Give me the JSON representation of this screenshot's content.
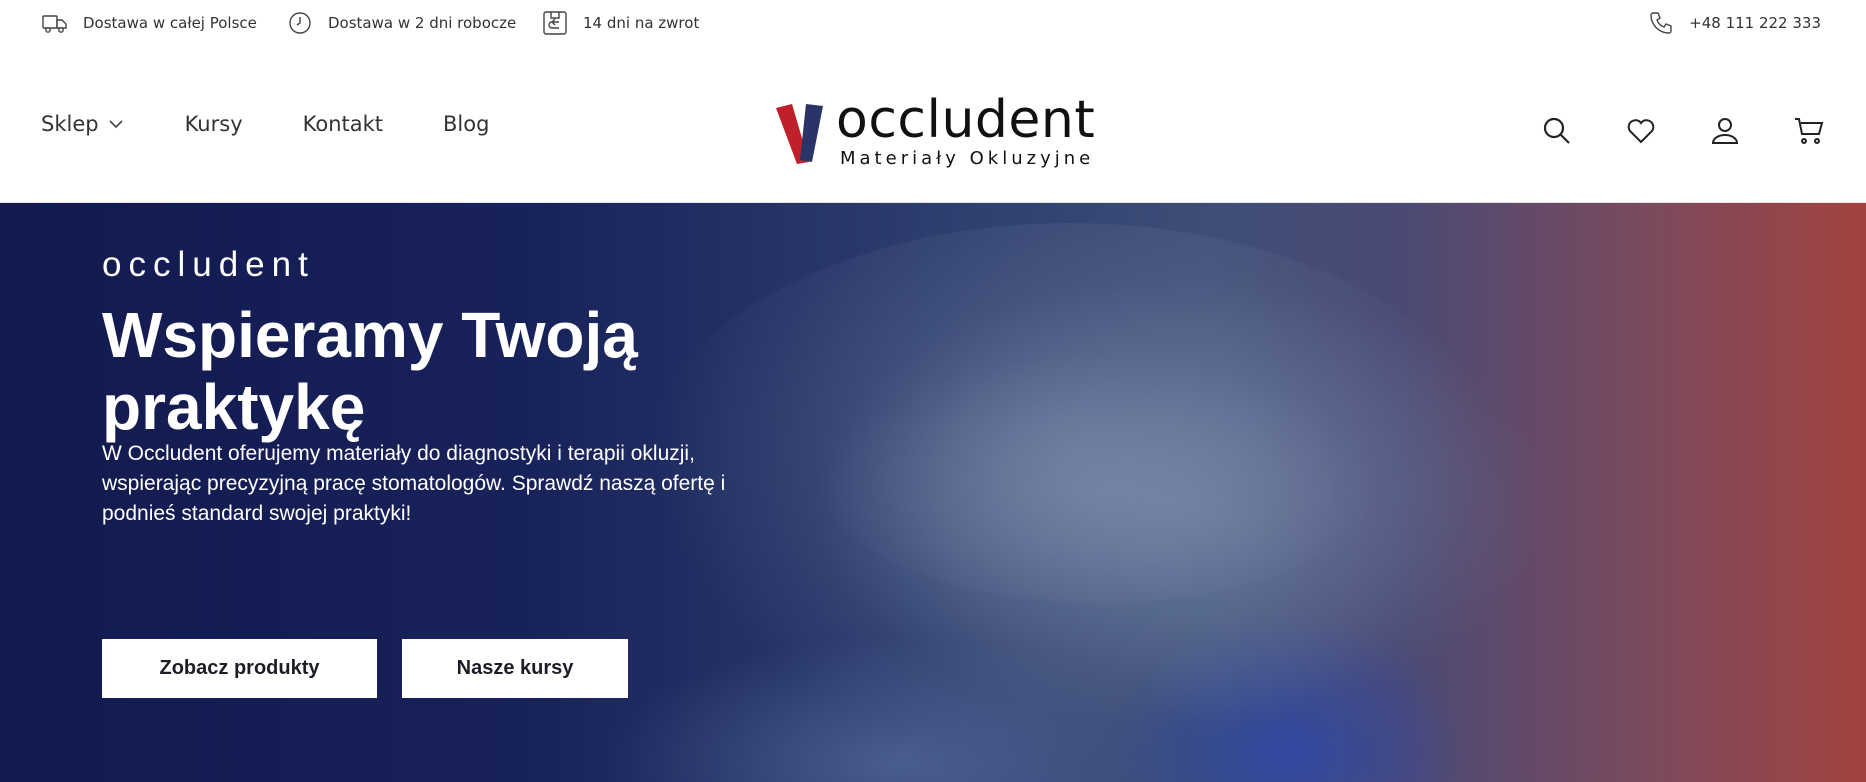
{
  "topbar": {
    "items": [
      {
        "label": "Dostawa w całej Polsce",
        "icon": "truck-icon"
      },
      {
        "label": "Dostawa w 2 dni robocze",
        "icon": "clock-icon"
      },
      {
        "label": "14 dni na zwrot",
        "icon": "return-box-icon"
      }
    ],
    "phone": {
      "label": "+48 111 222 333",
      "icon": "phone-icon"
    }
  },
  "nav": {
    "items": [
      {
        "label": "Sklep",
        "has_dropdown": true
      },
      {
        "label": "Kursy"
      },
      {
        "label": "Kontakt"
      },
      {
        "label": "Blog"
      }
    ]
  },
  "logo": {
    "text": "occludent",
    "subtitle": "Materiały Okluzyjne",
    "colors": {
      "red": "#c0202a",
      "navy": "#2a3466"
    }
  },
  "header_icons": [
    "search-icon",
    "heart-icon",
    "user-icon",
    "cart-icon"
  ],
  "hero": {
    "kicker": "occludent",
    "title": "Wspieramy Twoją praktykę",
    "description": "W Occludent oferujemy materiały do diagnostyki i terapii okluzji, wspierając precyzyjną pracę stomatologów. Sprawdź naszą ofertę i podnieś standard swojej praktyki!",
    "buttons": [
      {
        "label": "Zobacz produkty"
      },
      {
        "label": "Nasze kursy"
      }
    ]
  }
}
